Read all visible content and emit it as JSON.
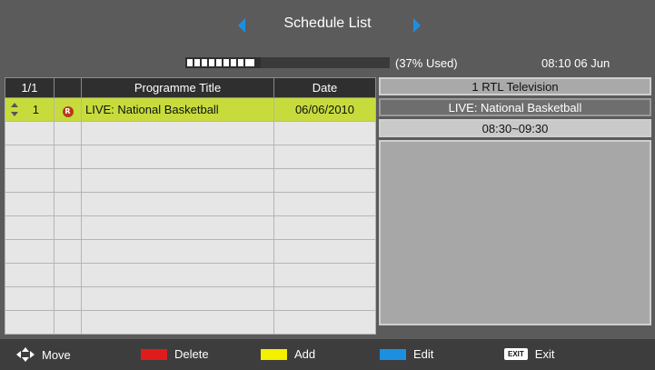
{
  "header": {
    "title": "Schedule List",
    "usage_text": "(37% Used)",
    "usage_percent": 37,
    "clock": "08:10  06 Jun"
  },
  "table": {
    "columns": [
      "1/1",
      "",
      "Programme Title",
      "Date"
    ],
    "rows": [
      {
        "num": "1",
        "flag": "R",
        "title": "LIVE: National Basketball",
        "date": "06/06/2010"
      },
      {
        "num": "",
        "flag": "",
        "title": "",
        "date": ""
      },
      {
        "num": "",
        "flag": "",
        "title": "",
        "date": ""
      },
      {
        "num": "",
        "flag": "",
        "title": "",
        "date": ""
      },
      {
        "num": "",
        "flag": "",
        "title": "",
        "date": ""
      },
      {
        "num": "",
        "flag": "",
        "title": "",
        "date": ""
      },
      {
        "num": "",
        "flag": "",
        "title": "",
        "date": ""
      },
      {
        "num": "",
        "flag": "",
        "title": "",
        "date": ""
      },
      {
        "num": "",
        "flag": "",
        "title": "",
        "date": ""
      },
      {
        "num": "",
        "flag": "",
        "title": "",
        "date": ""
      }
    ]
  },
  "detail": {
    "channel": "1 RTL Television",
    "event": "LIVE: National Basketball",
    "time": "08:30~09:30"
  },
  "footer": {
    "move": "Move",
    "delete": "Delete",
    "add": "Add",
    "edit": "Edit",
    "exit_key": "EXIT",
    "exit": "Exit"
  },
  "colors": {
    "delete": "#e01b1b",
    "add": "#f3f000",
    "edit": "#1c8fe0",
    "selected_row": "#c7dc3c"
  }
}
